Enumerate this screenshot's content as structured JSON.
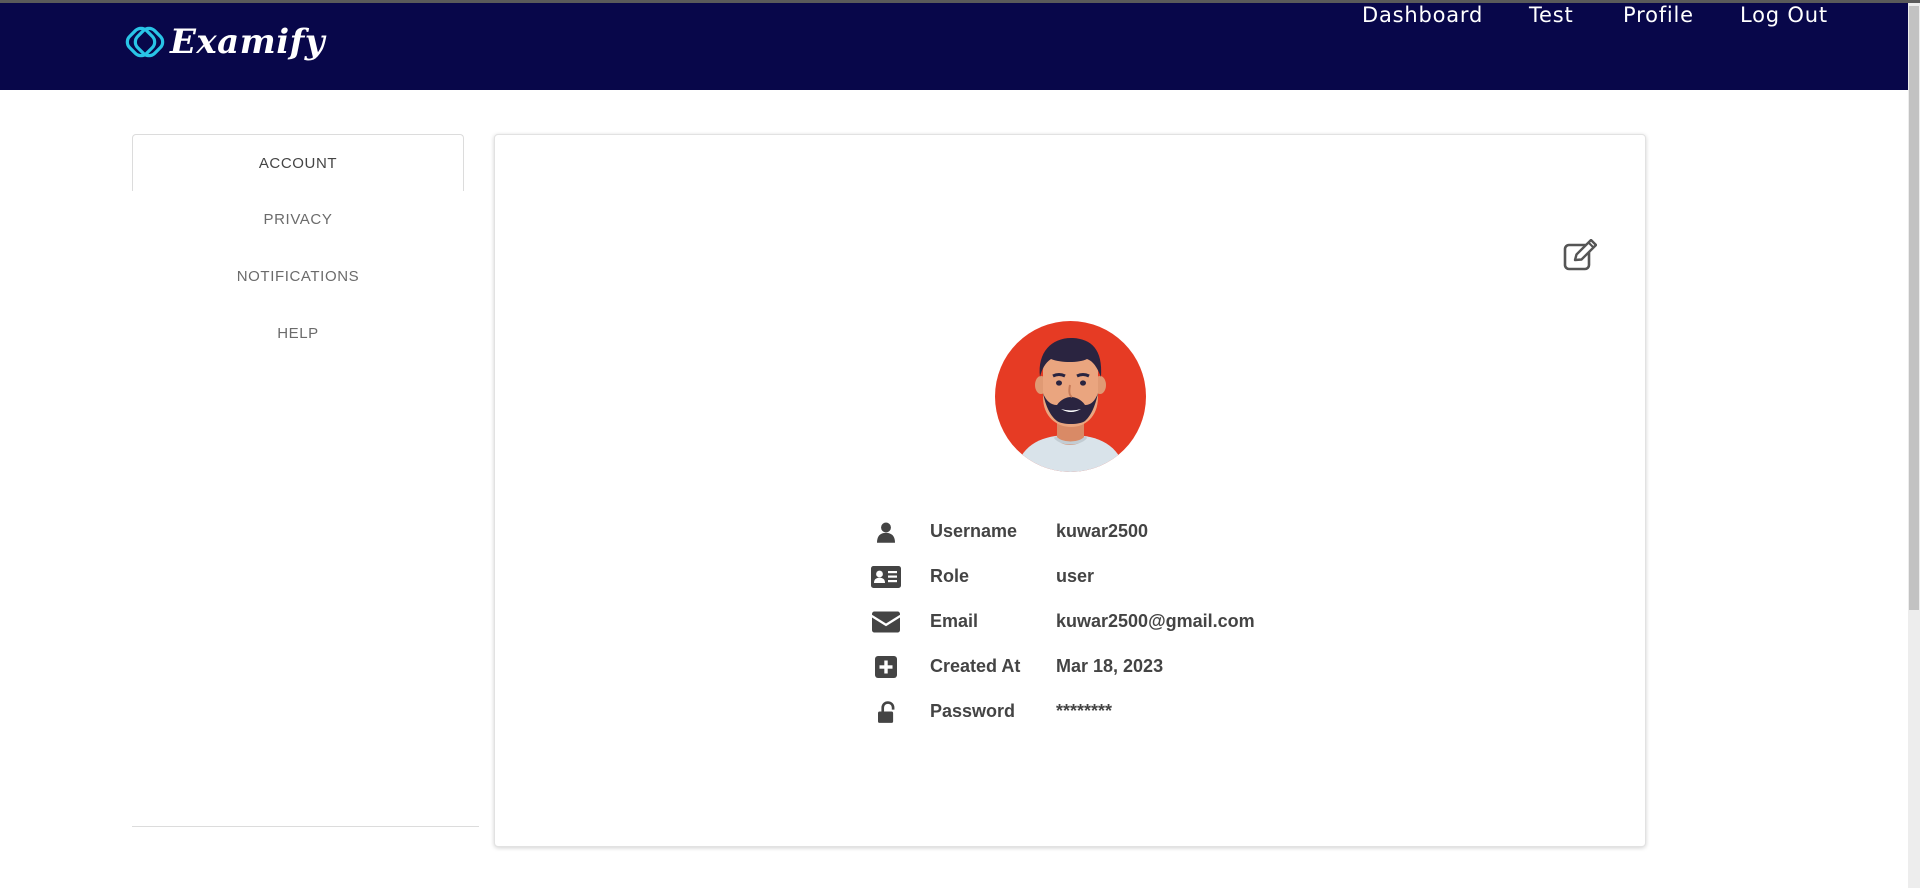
{
  "app": {
    "brand": "Examify"
  },
  "nav": {
    "links": [
      "Dashboard",
      "Test",
      "Profile",
      "Log Out"
    ]
  },
  "sidebar": {
    "items": [
      {
        "label": "ACCOUNT",
        "active": true
      },
      {
        "label": "PRIVACY",
        "active": false
      },
      {
        "label": "NOTIFICATIONS",
        "active": false
      },
      {
        "label": "HELP",
        "active": false
      }
    ]
  },
  "profile": {
    "fields": [
      {
        "icon": "user-icon",
        "label": "Username",
        "value": "kuwar2500"
      },
      {
        "icon": "id-card-icon",
        "label": "Role",
        "value": "user"
      },
      {
        "icon": "envelope-icon",
        "label": "Email",
        "value": "kuwar2500@gmail.com"
      },
      {
        "icon": "plus-square-icon",
        "label": "Created At",
        "value": "Mar 18, 2023"
      },
      {
        "icon": "unlock-icon",
        "label": "Password",
        "value": "********"
      }
    ]
  },
  "colors": {
    "navbar": "#08074a",
    "accent": "#29c4e6",
    "avatar_bg": "#e63b24",
    "text": "#444444"
  }
}
